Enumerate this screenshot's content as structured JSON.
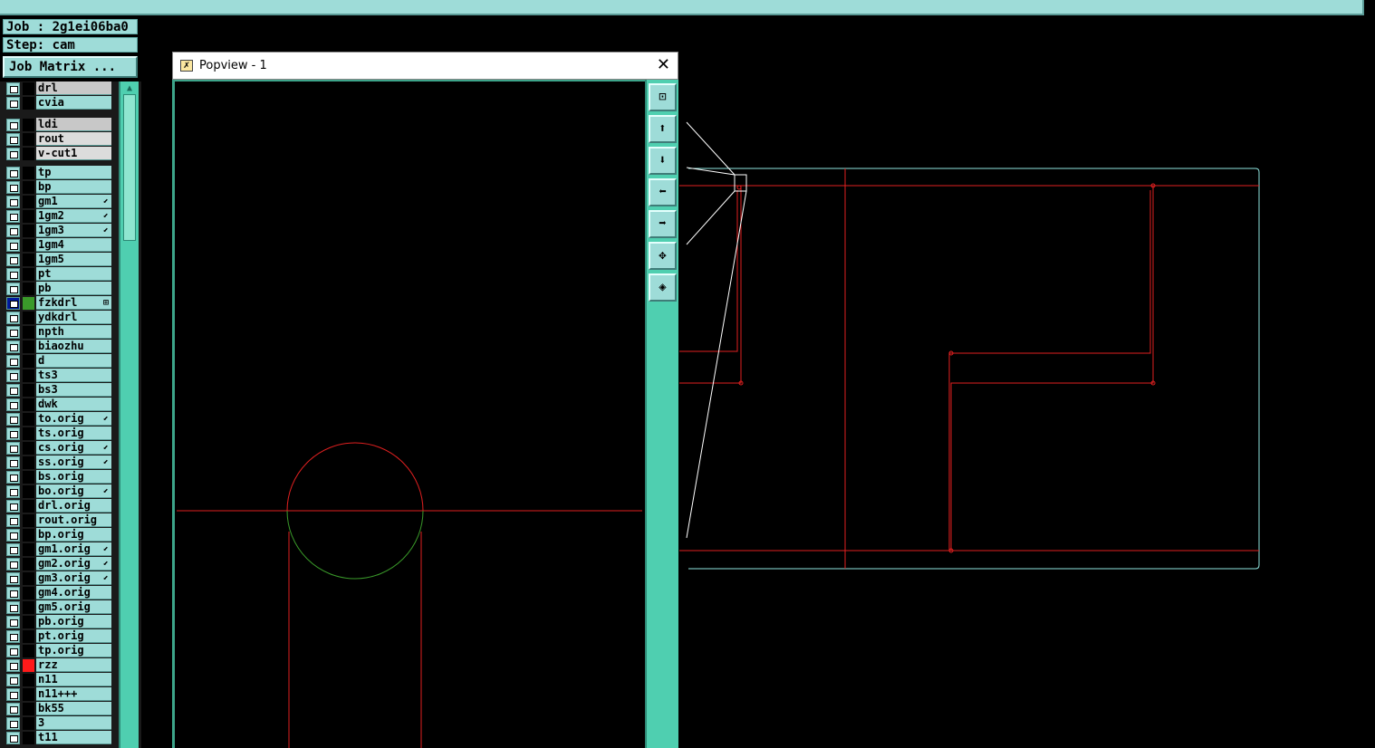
{
  "job_label": "Job : 2g1ei06ba0",
  "step_label": "Step: cam",
  "job_matrix_button": "Job Matrix ...",
  "popview": {
    "title": "Popview - 1",
    "close": "✕"
  },
  "tools": [
    {
      "name": "zoom-window-icon",
      "glyph": "⊡"
    },
    {
      "name": "pan-up-icon",
      "glyph": "⬆"
    },
    {
      "name": "pan-down-icon",
      "glyph": "⬇"
    },
    {
      "name": "pan-left-icon",
      "glyph": "⬅"
    },
    {
      "name": "pan-right-icon",
      "glyph": "➡"
    },
    {
      "name": "zoom-fit-icon",
      "glyph": "✥"
    },
    {
      "name": "zoom-center-icon",
      "glyph": "◈"
    }
  ],
  "layers": [
    {
      "name": "drl",
      "style": "grey",
      "swatch": "",
      "mark": ""
    },
    {
      "name": "cvia",
      "style": "",
      "swatch": "",
      "mark": ""
    },
    {
      "name": "ldi",
      "style": "grey",
      "swatch": "",
      "mark": ""
    },
    {
      "name": "rout",
      "style": "lgrey",
      "swatch": "",
      "mark": ""
    },
    {
      "name": "v-cut1",
      "style": "lgrey",
      "swatch": "",
      "mark": ""
    },
    {
      "name": "tp",
      "style": "",
      "swatch": "",
      "mark": ""
    },
    {
      "name": "bp",
      "style": "",
      "swatch": "",
      "mark": ""
    },
    {
      "name": "gm1",
      "style": "",
      "swatch": "",
      "mark": "⬋"
    },
    {
      "name": "1gm2",
      "style": "",
      "swatch": "",
      "mark": "⬋"
    },
    {
      "name": "1gm3",
      "style": "",
      "swatch": "",
      "mark": "⬋"
    },
    {
      "name": "1gm4",
      "style": "",
      "swatch": "",
      "mark": ""
    },
    {
      "name": "1gm5",
      "style": "",
      "swatch": "",
      "mark": ""
    },
    {
      "name": "pt",
      "style": "",
      "swatch": "",
      "mark": ""
    },
    {
      "name": "pb",
      "style": "",
      "swatch": "",
      "mark": ""
    },
    {
      "name": "fzkdrl",
      "style": "",
      "swatch": "#3a9a2a",
      "mark": "⊞",
      "selected": true
    },
    {
      "name": "ydkdrl",
      "style": "",
      "swatch": "",
      "mark": ""
    },
    {
      "name": "npth",
      "style": "",
      "swatch": "",
      "mark": ""
    },
    {
      "name": "biaozhu",
      "style": "",
      "swatch": "",
      "mark": ""
    },
    {
      "name": "d",
      "style": "",
      "swatch": "",
      "mark": ""
    },
    {
      "name": "ts3",
      "style": "",
      "swatch": "",
      "mark": ""
    },
    {
      "name": "bs3",
      "style": "",
      "swatch": "",
      "mark": ""
    },
    {
      "name": "dwk",
      "style": "",
      "swatch": "",
      "mark": ""
    },
    {
      "name": "to.orig",
      "style": "",
      "swatch": "",
      "mark": "⬋"
    },
    {
      "name": "ts.orig",
      "style": "",
      "swatch": "",
      "mark": ""
    },
    {
      "name": "cs.orig",
      "style": "",
      "swatch": "",
      "mark": "⬋"
    },
    {
      "name": "ss.orig",
      "style": "",
      "swatch": "",
      "mark": "⬋"
    },
    {
      "name": "bs.orig",
      "style": "",
      "swatch": "",
      "mark": ""
    },
    {
      "name": "bo.orig",
      "style": "",
      "swatch": "",
      "mark": "⬋"
    },
    {
      "name": "drl.orig",
      "style": "",
      "swatch": "",
      "mark": ""
    },
    {
      "name": "rout.orig",
      "style": "",
      "swatch": "",
      "mark": ""
    },
    {
      "name": "bp.orig",
      "style": "",
      "swatch": "",
      "mark": ""
    },
    {
      "name": "gm1.orig",
      "style": "",
      "swatch": "",
      "mark": "⬋"
    },
    {
      "name": "gm2.orig",
      "style": "",
      "swatch": "",
      "mark": "⬋"
    },
    {
      "name": "gm3.orig",
      "style": "",
      "swatch": "",
      "mark": "⬋"
    },
    {
      "name": "gm4.orig",
      "style": "",
      "swatch": "",
      "mark": ""
    },
    {
      "name": "gm5.orig",
      "style": "",
      "swatch": "",
      "mark": ""
    },
    {
      "name": "pb.orig",
      "style": "",
      "swatch": "",
      "mark": ""
    },
    {
      "name": "pt.orig",
      "style": "",
      "swatch": "",
      "mark": ""
    },
    {
      "name": "tp.orig",
      "style": "",
      "swatch": "",
      "mark": ""
    },
    {
      "name": "rzz",
      "style": "",
      "swatch": "#ff1a1a",
      "mark": ""
    },
    {
      "name": "n11",
      "style": "",
      "swatch": "",
      "mark": ""
    },
    {
      "name": "n11+++",
      "style": "",
      "swatch": "",
      "mark": ""
    },
    {
      "name": "bk55",
      "style": "",
      "swatch": "",
      "mark": ""
    },
    {
      "name": "3",
      "style": "",
      "swatch": "",
      "mark": ""
    },
    {
      "name": "t11",
      "style": "",
      "swatch": "",
      "mark": ""
    }
  ],
  "colors": {
    "panel": "#9edcd8",
    "scrollbar": "#4fcfb0",
    "feature": "#e02020",
    "outline": "#8fe6e0"
  }
}
